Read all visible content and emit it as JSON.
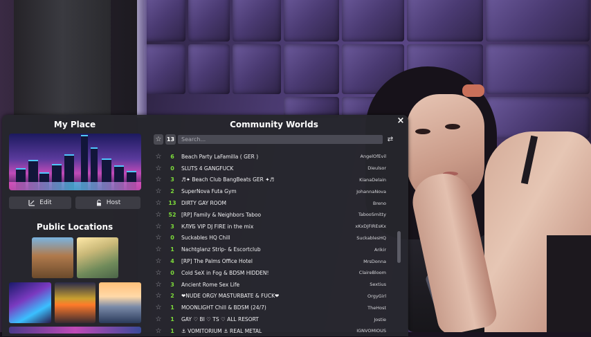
{
  "panel": {
    "close_glyph": "×",
    "my_place": {
      "title": "My Place",
      "edit_label": "Edit",
      "host_label": "Host"
    },
    "public_locations": {
      "title": "Public Locations"
    },
    "community": {
      "title": "Community Worlds",
      "favorites_count": "13",
      "search_placeholder": "Search...",
      "worlds": [
        {
          "count": "6",
          "name": "Beach Party LaFamilla ( GER )",
          "owner": "AngelOfEvil"
        },
        {
          "count": "0",
          "name": "SLUTS 4 GANGFUCK",
          "owner": "Dieulsor"
        },
        {
          "count": "3",
          "name": "♬✦ Beach Club BangBeats GER ✦♬",
          "owner": "KianaDelain"
        },
        {
          "count": "2",
          "name": "SuperNova Futa Gym",
          "owner": "JohannaNova"
        },
        {
          "count": "13",
          "name": "DIRTY GAY ROOM",
          "owner": "Breno"
        },
        {
          "count": "52",
          "name": "[RP] Family & Neighbors Taboo",
          "owner": "TabooSmitty"
        },
        {
          "count": "3",
          "name": "КЛУБ VIP DJ FIRE in the mix",
          "owner": "xKxDJFIREsKx"
        },
        {
          "count": "0",
          "name": "Suckables HQ Chill",
          "owner": "SuckablesHQ"
        },
        {
          "count": "1",
          "name": "Nachtglanz Strip- & Escortclub",
          "owner": "Arikir"
        },
        {
          "count": "4",
          "name": "[RP] The Palms Office Hotel",
          "owner": "MrsDonna"
        },
        {
          "count": "0",
          "name": "Cold SeX in Fog & BDSM HIDDEN!",
          "owner": "ClaireBloom"
        },
        {
          "count": "3",
          "name": "Ancient Rome Sex Life",
          "owner": "Sextius"
        },
        {
          "count": "2",
          "name": "❤NUDE ORGY MASTURBATE & FUCK❤",
          "owner": "OrgyGirl"
        },
        {
          "count": "1",
          "name": "MOONLIGHT Chill & BDSM (24/7)",
          "owner": "TheHost"
        },
        {
          "count": "1",
          "name": "GAY ♡ BI ♡ TS ♡ ALL RESORT",
          "owner": "Jostie"
        },
        {
          "count": "1",
          "name": "⚓ VOMITORIUM ⚓ REAL METAL",
          "owner": "IGNVOMIOUS"
        }
      ]
    }
  },
  "colors": {
    "panel_bg": "#26262c",
    "count_green": "#7ddc3a",
    "wall_purple": "#5a4686"
  },
  "icons": [
    "close-icon",
    "edit-icon",
    "unlock-icon",
    "star-icon",
    "refresh-icon"
  ]
}
